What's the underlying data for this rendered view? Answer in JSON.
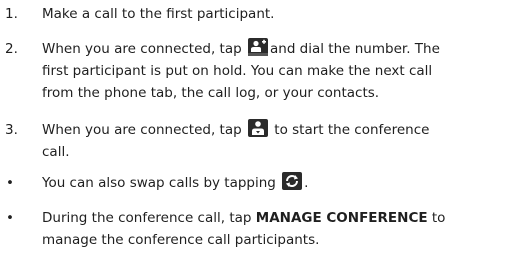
{
  "steps": [
    {
      "number": "1.",
      "lines": [
        "Make a call to the first participant."
      ]
    },
    {
      "number": "2.",
      "line1_before": "When you are connected, tap",
      "icon": "add-call-icon",
      "line1_after": "and dial the number. The",
      "lines": [
        "first participant is put on hold. You can make the next call",
        "from the phone tab, the call log, or your contacts."
      ]
    },
    {
      "number": "3.",
      "line1_before": "When you are connected, tap",
      "icon": "merge-calls-icon",
      "line1_after": "to start the conference",
      "lines": [
        "call."
      ]
    }
  ],
  "bullets": [
    {
      "marker": "•",
      "before": "You can also swap calls by tapping",
      "icon": "swap-calls-icon",
      "after": "."
    },
    {
      "marker": "•",
      "before": "During the conference call, tap",
      "bold": "MANAGE CONFERENCE",
      "after": "to",
      "lines": [
        "manage the conference call participants."
      ]
    }
  ]
}
